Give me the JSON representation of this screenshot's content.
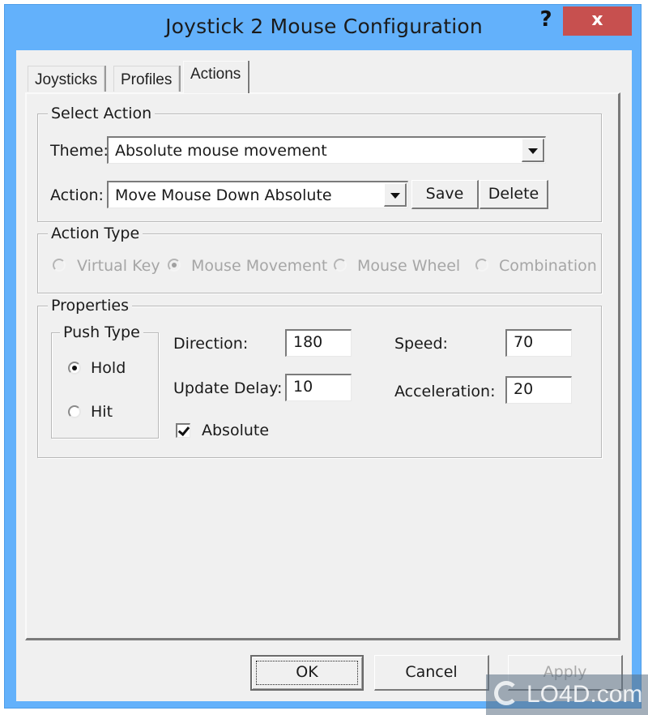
{
  "window": {
    "title": "Joystick 2 Mouse Configuration",
    "help_label": "?",
    "close_label": "x",
    "colors": {
      "frame": "#63b1fb",
      "close": "#c7504f",
      "client": "#f0f0f0"
    }
  },
  "tabs": [
    {
      "label": "Joysticks",
      "active": false
    },
    {
      "label": "Profiles",
      "active": false
    },
    {
      "label": "Actions",
      "active": true
    }
  ],
  "select_action": {
    "group_label": "Select Action",
    "theme_label": "Theme:",
    "theme_value": "Absolute mouse movement",
    "action_label": "Action:",
    "action_value": "Move Mouse Down Absolute",
    "save_label": "Save",
    "delete_label": "Delete"
  },
  "action_type": {
    "group_label": "Action Type",
    "options": [
      {
        "label": "Virtual Key",
        "checked": false,
        "enabled": false
      },
      {
        "label": "Mouse Movement",
        "checked": true,
        "enabled": false
      },
      {
        "label": "Mouse Wheel",
        "checked": false,
        "enabled": false
      },
      {
        "label": "Combination",
        "checked": false,
        "enabled": false
      }
    ]
  },
  "properties": {
    "group_label": "Properties",
    "push_type": {
      "group_label": "Push Type",
      "options": [
        {
          "label": "Hold",
          "checked": true
        },
        {
          "label": "Hit",
          "checked": false
        }
      ]
    },
    "direction_label": "Direction:",
    "direction_value": "180",
    "update_delay_label": "Update Delay:",
    "update_delay_value": "10",
    "speed_label": "Speed:",
    "speed_value": "70",
    "acceleration_label": "Acceleration:",
    "acceleration_value": "20",
    "absolute_label": "Absolute",
    "absolute_checked": true
  },
  "footer": {
    "ok_label": "OK",
    "cancel_label": "Cancel",
    "apply_label": "Apply"
  },
  "watermark": {
    "text": "LO4D.com"
  }
}
